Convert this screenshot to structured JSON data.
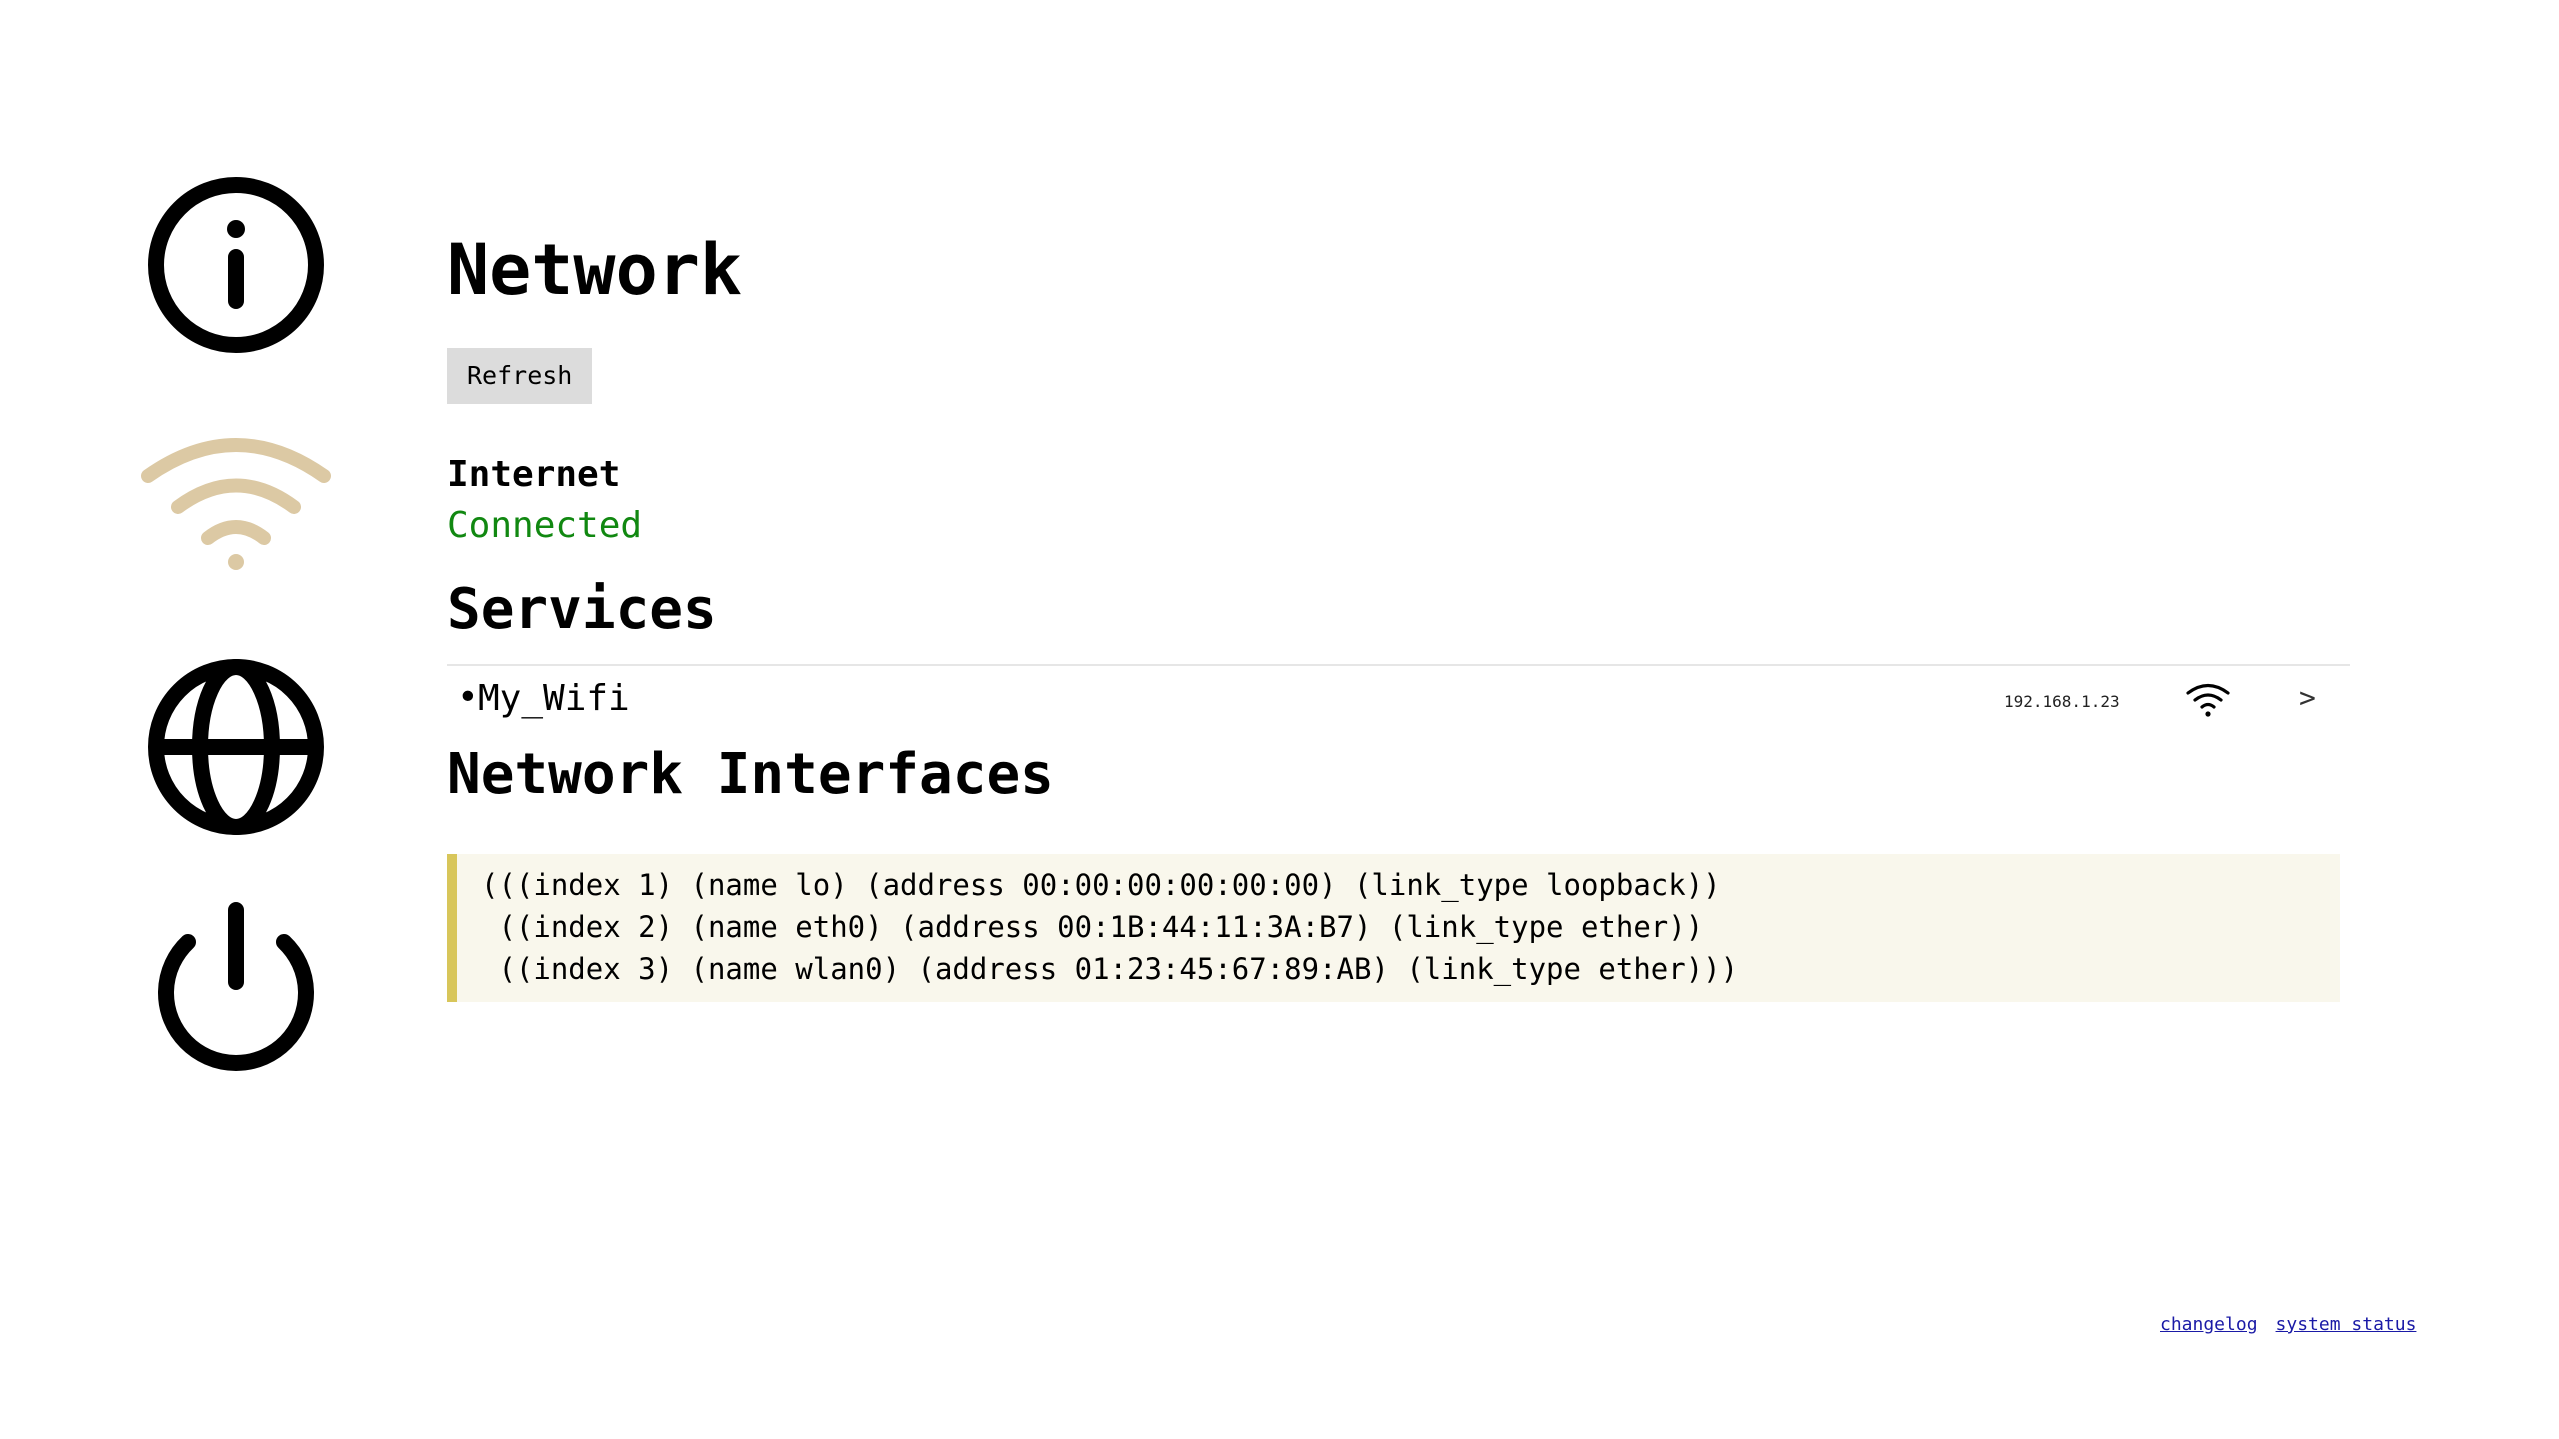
{
  "sidebar": {
    "items": [
      {
        "icon": "info-icon"
      },
      {
        "icon": "wifi-icon",
        "active": true,
        "color": "#dcc9a4"
      },
      {
        "icon": "globe-icon"
      },
      {
        "icon": "power-icon"
      }
    ]
  },
  "page": {
    "title": "Network",
    "refresh_label": "Refresh"
  },
  "internet": {
    "label": "Internet",
    "status": "Connected",
    "status_color": "#118811"
  },
  "services": {
    "title": "Services",
    "items": [
      {
        "name": "My_Wifi",
        "ip": "192.168.1.23",
        "icon": "wifi-signal-icon",
        "chevron": ">"
      }
    ]
  },
  "interfaces": {
    "title": "Network Interfaces",
    "text": "(((index 1) (name lo) (address 00:00:00:00:00:00) (link_type loopback))\n ((index 2) (name eth0) (address 00:1B:44:11:3A:B7) (link_type ether))\n ((index 3) (name wlan0) (address 01:23:45:67:89:AB) (link_type ether)))"
  },
  "footer": {
    "links": [
      "changelog",
      "system status"
    ]
  },
  "colors": {
    "accent_wifi": "#dcc9a4",
    "connected": "#118811",
    "code_border": "#d8c65a",
    "code_bg": "#f9f7ec",
    "link": "#1a1aa6"
  }
}
